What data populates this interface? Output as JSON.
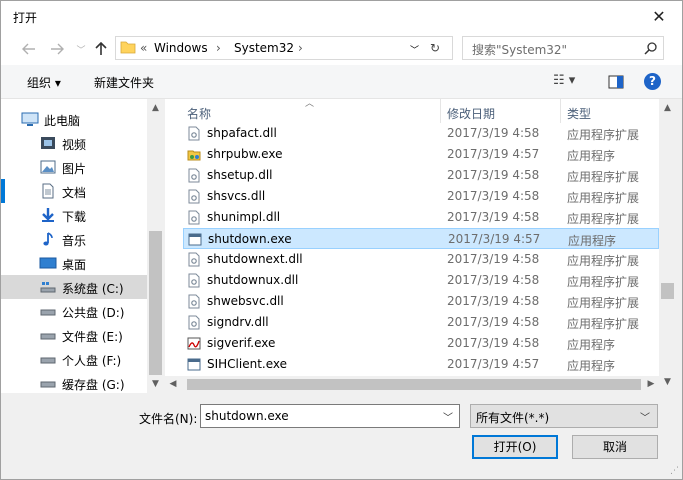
{
  "window": {
    "title": "打开",
    "close_glyph": "✕"
  },
  "nav": {
    "address": {
      "prefix": "«",
      "crumbs": [
        "Windows",
        "System32"
      ],
      "sep": "›"
    },
    "search_placeholder": "搜索\"System32\""
  },
  "toolbar": {
    "organize": "组织 ▾",
    "new_folder": "新建文件夹"
  },
  "sidebar": {
    "items": [
      {
        "label": "此电脑",
        "icon": "computer-icon"
      },
      {
        "label": "视频",
        "icon": "video-icon"
      },
      {
        "label": "图片",
        "icon": "pictures-icon"
      },
      {
        "label": "文档",
        "icon": "documents-icon"
      },
      {
        "label": "下载",
        "icon": "download-icon"
      },
      {
        "label": "音乐",
        "icon": "music-icon"
      },
      {
        "label": "桌面",
        "icon": "desktop-icon"
      },
      {
        "label": "系统盘 (C:)",
        "icon": "system-drive-icon"
      },
      {
        "label": "公共盘 (D:)",
        "icon": "drive-icon"
      },
      {
        "label": "文件盘 (E:)",
        "icon": "drive-icon"
      },
      {
        "label": "个人盘 (F:)",
        "icon": "drive-icon"
      },
      {
        "label": "缓存盘 (G:)",
        "icon": "drive-icon"
      }
    ]
  },
  "files": {
    "columns": {
      "name": "名称",
      "date": "修改日期",
      "type": "类型"
    },
    "rows": [
      {
        "name": "shpafact.dll",
        "date": "2017/3/19 4:58",
        "type": "应用程序扩展",
        "kind": "dll"
      },
      {
        "name": "shrpubw.exe",
        "date": "2017/3/19 4:57",
        "type": "应用程序",
        "kind": "exe-share"
      },
      {
        "name": "shsetup.dll",
        "date": "2017/3/19 4:58",
        "type": "应用程序扩展",
        "kind": "dll"
      },
      {
        "name": "shsvcs.dll",
        "date": "2017/3/19 4:58",
        "type": "应用程序扩展",
        "kind": "dll"
      },
      {
        "name": "shunimpl.dll",
        "date": "2017/3/19 4:58",
        "type": "应用程序扩展",
        "kind": "dll"
      },
      {
        "name": "shutdown.exe",
        "date": "2017/3/19 4:57",
        "type": "应用程序",
        "kind": "exe"
      },
      {
        "name": "shutdownext.dll",
        "date": "2017/3/19 4:58",
        "type": "应用程序扩展",
        "kind": "dll"
      },
      {
        "name": "shutdownux.dll",
        "date": "2017/3/19 4:58",
        "type": "应用程序扩展",
        "kind": "dll"
      },
      {
        "name": "shwebsvc.dll",
        "date": "2017/3/19 4:58",
        "type": "应用程序扩展",
        "kind": "dll"
      },
      {
        "name": "signdrv.dll",
        "date": "2017/3/19 4:58",
        "type": "应用程序扩展",
        "kind": "dll"
      },
      {
        "name": "sigverif.exe",
        "date": "2017/3/19 4:58",
        "type": "应用程序",
        "kind": "exe-sig"
      },
      {
        "name": "SIHClient.exe",
        "date": "2017/3/19 4:57",
        "type": "应用程序",
        "kind": "exe"
      }
    ]
  },
  "bottom": {
    "filename_label": "文件名(N):",
    "filename_value": "shutdown.exe",
    "filetype_value": "所有文件(*.*)",
    "open_label": "打开(O)",
    "cancel_label": "取消"
  },
  "colors": {
    "accent": "#0078d7",
    "selection": "#cce8ff"
  }
}
